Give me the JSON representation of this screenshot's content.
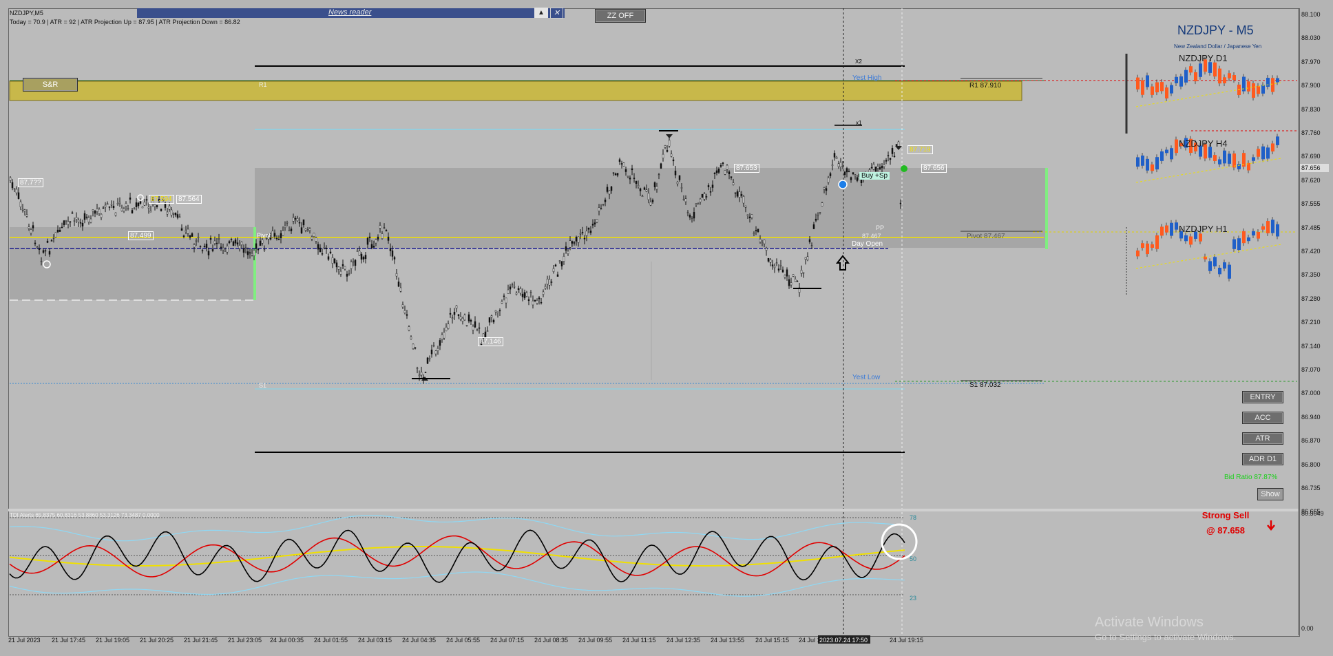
{
  "symbol": "NZDJPY,M5",
  "info_line": "Today = 70.9   |   ATR = 92   |   ATR Projection Up = 87.95   |   ATR Projection Down = 86.82",
  "news_reader": "News reader",
  "zz_button": "ZZ OFF",
  "sr_button": "S&R",
  "panel": {
    "title": "NZDJPY - M5",
    "subtitle": "New Zealand Dollar / Japanese Yen",
    "mini_d1": "NZDJPY D1",
    "mini_h4": "NZDJPY H4",
    "mini_h1": "NZDJPY H1"
  },
  "buttons": {
    "entry": "ENTRY",
    "acc": "ACC",
    "atr": "ATR",
    "adr": "ADR D1",
    "show": "Show"
  },
  "bid_ratio": "Bid Ratio 87.87%",
  "signal": {
    "line1": "Strong Sell",
    "line2": "@ 87.658"
  },
  "levels": {
    "r1": "R1 87.910",
    "s1": "S1 87.032",
    "pivot": "Pivot 87.467",
    "pp": "PP",
    "pp_value": "87.467",
    "day_open": "Day Open",
    "yest_high": "Yest High",
    "yest_low": "Yest Low",
    "x2": "X2",
    "x1": "x1",
    "r1_short": "R1",
    "s1_short": "S1",
    "pivot_short": "Pivot",
    "buy_sp": "Buy +Sp"
  },
  "price_tags": {
    "t1": "87.7??",
    "t2": "87.594",
    "t3": "87.564",
    "t4": "87.499",
    "t5": "87.653",
    "t6": "87.146",
    "t7": "87.719",
    "t8": "87.656"
  },
  "price_axis": [
    "88.100",
    "88.030",
    "87.970",
    "87.900",
    "87.830",
    "87.760",
    "87.690",
    "87.620",
    "87.555",
    "87.485",
    "87.420",
    "87.350",
    "87.280",
    "87.210",
    "87.140",
    "87.070",
    "87.000",
    "86.940",
    "86.870",
    "86.800",
    "86.735",
    "86.665"
  ],
  "current_price": "87.656",
  "osc_axis": {
    "top": "80.5049",
    "bottom": "0.00"
  },
  "osc_levels": {
    "hi": "78",
    "mid": "50",
    "lo": "23"
  },
  "osc_header": "TDI Alerts 65.8375 60.8316 53.8860 53.3126 73.3487 0.0000",
  "time_axis": [
    "21 Jul 2023",
    "21 Jul 17:45",
    "21 Jul 19:05",
    "21 Jul 20:25",
    "21 Jul 21:45",
    "21 Jul 23:05",
    "24 Jul 00:35",
    "24 Jul 01:55",
    "24 Jul 03:15",
    "24 Jul 04:35",
    "24 Jul 05:55",
    "24 Jul 07:15",
    "24 Jul 08:35",
    "24 Jul 09:55",
    "24 Jul 11:15",
    "24 Jul 12:35",
    "24 Jul 13:55",
    "24 Jul 15:15",
    "24 Jul 16:35",
    "24 Jul 19:15"
  ],
  "cursor_time": "2023.07.24 17:50",
  "watermark": {
    "line1": "Activate Windows",
    "line2": "Go to Settings to activate Windows."
  },
  "colors": {
    "buy": "#1f5fc8",
    "sell": "#ff5a1e",
    "signal": "#e00000",
    "pivot": "#f0e000",
    "zone": "#c8b84a"
  }
}
